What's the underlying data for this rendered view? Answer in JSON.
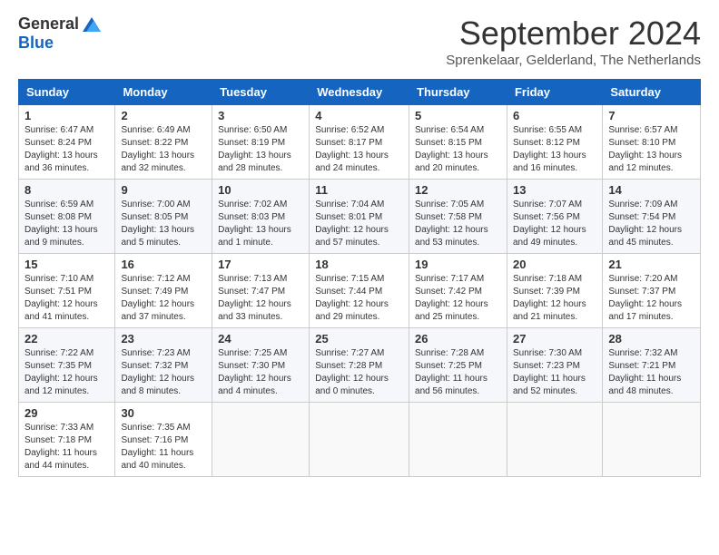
{
  "header": {
    "logo_general": "General",
    "logo_blue": "Blue",
    "month_title": "September 2024",
    "subtitle": "Sprenkelaar, Gelderland, The Netherlands"
  },
  "weekdays": [
    "Sunday",
    "Monday",
    "Tuesday",
    "Wednesday",
    "Thursday",
    "Friday",
    "Saturday"
  ],
  "weeks": [
    [
      {
        "day": "1",
        "info": "Sunrise: 6:47 AM\nSunset: 8:24 PM\nDaylight: 13 hours\nand 36 minutes."
      },
      {
        "day": "2",
        "info": "Sunrise: 6:49 AM\nSunset: 8:22 PM\nDaylight: 13 hours\nand 32 minutes."
      },
      {
        "day": "3",
        "info": "Sunrise: 6:50 AM\nSunset: 8:19 PM\nDaylight: 13 hours\nand 28 minutes."
      },
      {
        "day": "4",
        "info": "Sunrise: 6:52 AM\nSunset: 8:17 PM\nDaylight: 13 hours\nand 24 minutes."
      },
      {
        "day": "5",
        "info": "Sunrise: 6:54 AM\nSunset: 8:15 PM\nDaylight: 13 hours\nand 20 minutes."
      },
      {
        "day": "6",
        "info": "Sunrise: 6:55 AM\nSunset: 8:12 PM\nDaylight: 13 hours\nand 16 minutes."
      },
      {
        "day": "7",
        "info": "Sunrise: 6:57 AM\nSunset: 8:10 PM\nDaylight: 13 hours\nand 12 minutes."
      }
    ],
    [
      {
        "day": "8",
        "info": "Sunrise: 6:59 AM\nSunset: 8:08 PM\nDaylight: 13 hours\nand 9 minutes."
      },
      {
        "day": "9",
        "info": "Sunrise: 7:00 AM\nSunset: 8:05 PM\nDaylight: 13 hours\nand 5 minutes."
      },
      {
        "day": "10",
        "info": "Sunrise: 7:02 AM\nSunset: 8:03 PM\nDaylight: 13 hours\nand 1 minute."
      },
      {
        "day": "11",
        "info": "Sunrise: 7:04 AM\nSunset: 8:01 PM\nDaylight: 12 hours\nand 57 minutes."
      },
      {
        "day": "12",
        "info": "Sunrise: 7:05 AM\nSunset: 7:58 PM\nDaylight: 12 hours\nand 53 minutes."
      },
      {
        "day": "13",
        "info": "Sunrise: 7:07 AM\nSunset: 7:56 PM\nDaylight: 12 hours\nand 49 minutes."
      },
      {
        "day": "14",
        "info": "Sunrise: 7:09 AM\nSunset: 7:54 PM\nDaylight: 12 hours\nand 45 minutes."
      }
    ],
    [
      {
        "day": "15",
        "info": "Sunrise: 7:10 AM\nSunset: 7:51 PM\nDaylight: 12 hours\nand 41 minutes."
      },
      {
        "day": "16",
        "info": "Sunrise: 7:12 AM\nSunset: 7:49 PM\nDaylight: 12 hours\nand 37 minutes."
      },
      {
        "day": "17",
        "info": "Sunrise: 7:13 AM\nSunset: 7:47 PM\nDaylight: 12 hours\nand 33 minutes."
      },
      {
        "day": "18",
        "info": "Sunrise: 7:15 AM\nSunset: 7:44 PM\nDaylight: 12 hours\nand 29 minutes."
      },
      {
        "day": "19",
        "info": "Sunrise: 7:17 AM\nSunset: 7:42 PM\nDaylight: 12 hours\nand 25 minutes."
      },
      {
        "day": "20",
        "info": "Sunrise: 7:18 AM\nSunset: 7:39 PM\nDaylight: 12 hours\nand 21 minutes."
      },
      {
        "day": "21",
        "info": "Sunrise: 7:20 AM\nSunset: 7:37 PM\nDaylight: 12 hours\nand 17 minutes."
      }
    ],
    [
      {
        "day": "22",
        "info": "Sunrise: 7:22 AM\nSunset: 7:35 PM\nDaylight: 12 hours\nand 12 minutes."
      },
      {
        "day": "23",
        "info": "Sunrise: 7:23 AM\nSunset: 7:32 PM\nDaylight: 12 hours\nand 8 minutes."
      },
      {
        "day": "24",
        "info": "Sunrise: 7:25 AM\nSunset: 7:30 PM\nDaylight: 12 hours\nand 4 minutes."
      },
      {
        "day": "25",
        "info": "Sunrise: 7:27 AM\nSunset: 7:28 PM\nDaylight: 12 hours\nand 0 minutes."
      },
      {
        "day": "26",
        "info": "Sunrise: 7:28 AM\nSunset: 7:25 PM\nDaylight: 11 hours\nand 56 minutes."
      },
      {
        "day": "27",
        "info": "Sunrise: 7:30 AM\nSunset: 7:23 PM\nDaylight: 11 hours\nand 52 minutes."
      },
      {
        "day": "28",
        "info": "Sunrise: 7:32 AM\nSunset: 7:21 PM\nDaylight: 11 hours\nand 48 minutes."
      }
    ],
    [
      {
        "day": "29",
        "info": "Sunrise: 7:33 AM\nSunset: 7:18 PM\nDaylight: 11 hours\nand 44 minutes."
      },
      {
        "day": "30",
        "info": "Sunrise: 7:35 AM\nSunset: 7:16 PM\nDaylight: 11 hours\nand 40 minutes."
      },
      null,
      null,
      null,
      null,
      null
    ]
  ]
}
